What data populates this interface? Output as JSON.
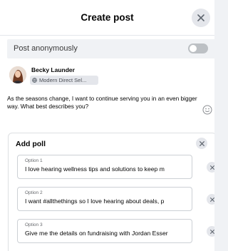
{
  "dialog": {
    "title": "Create post"
  },
  "anonymous": {
    "label": "Post anonymously",
    "enabled": false
  },
  "author": {
    "name": "Becky Launder",
    "audience": "Modern Direct Sel..."
  },
  "post": {
    "text": "As the seasons change, I want to continue serving you in an even bigger way. What best describes you?"
  },
  "poll": {
    "title": "Add poll",
    "options": [
      {
        "label": "Option 1",
        "value": "I love hearing wellness tips and solutions to keep m"
      },
      {
        "label": "Option 2",
        "value": "I want #allthethings so I love hearing about deals, p"
      },
      {
        "label": "Option 3",
        "value": "Give me the details on fundraising with Jordan Esser"
      }
    ]
  },
  "icons": {
    "close": "close-icon",
    "globe": "globe-icon",
    "emoji": "emoji-icon"
  },
  "colors": {
    "background": "#ffffff",
    "panel": "#f0f2f5",
    "button_bg": "#e4e6eb",
    "text": "#050505",
    "secondary_text": "#65676b",
    "toggle_off": "#bcc0c4"
  }
}
